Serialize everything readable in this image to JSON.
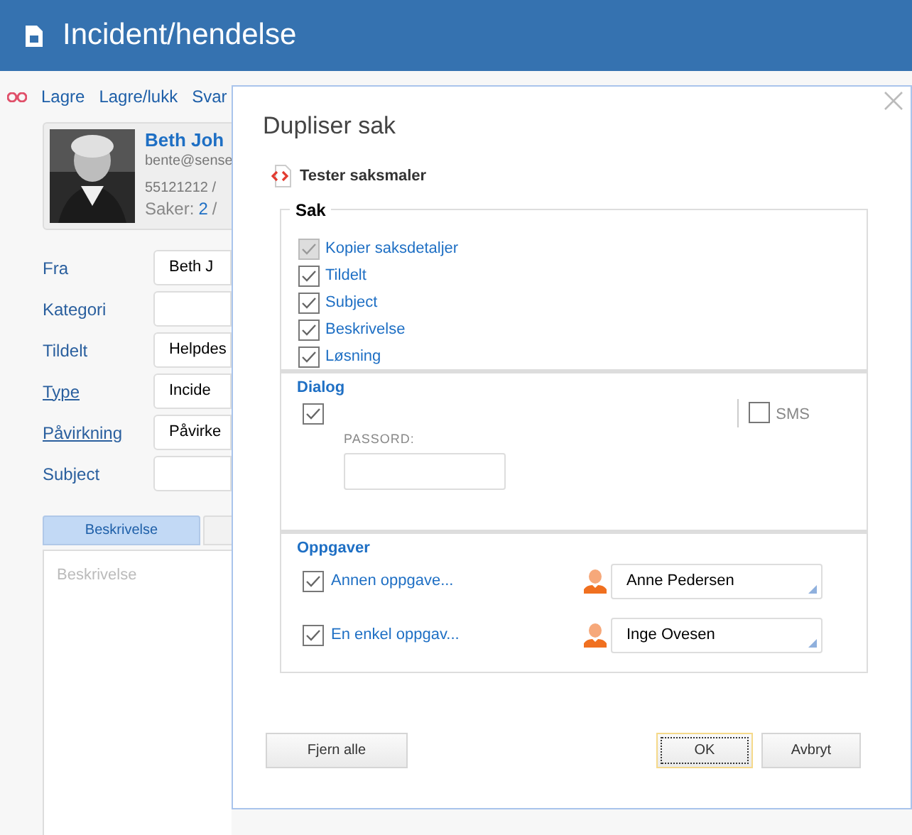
{
  "header": {
    "title": "Incident/hendelse"
  },
  "toolbar": [
    "Lagre",
    "Lagre/lukk",
    "Svar"
  ],
  "contact": {
    "name": "Beth Joh",
    "email": "bente@sense",
    "phone": "55121212 /",
    "cases_label": "Saker:",
    "cases_value": "2",
    "cases_sep": "/"
  },
  "form": [
    {
      "label": "Fra",
      "value": "Beth J",
      "link": false
    },
    {
      "label": "Kategori",
      "link": false
    },
    {
      "label": "Tildelt",
      "value": "Helpdes",
      "link": false
    },
    {
      "label": "Type",
      "value": "Incide",
      "link": true
    },
    {
      "label": "Påvirkning",
      "value": "Påvirke",
      "link": true
    },
    {
      "label": "Subject",
      "link": false
    }
  ],
  "tabs": [
    {
      "label": "Beskrivelse",
      "selected": true
    },
    {
      "selected": false
    }
  ],
  "description": {
    "placeholder": "Beskrivelse"
  },
  "dialog": {
    "title": "Dupliser sak",
    "template": "Tester saksmaler",
    "sak": {
      "legend": "Sak",
      "items": [
        {
          "label": "Kopier saksdetaljer",
          "checked": true,
          "disabled": true
        },
        {
          "label": "Tildelt",
          "checked": true,
          "disabled": false
        },
        {
          "label": "Subject",
          "checked": true,
          "disabled": false
        },
        {
          "label": "Beskrivelse",
          "checked": true,
          "disabled": false
        },
        {
          "label": "Løsning",
          "checked": true,
          "disabled": false
        }
      ]
    },
    "dialog_section": {
      "heading": "Dialog",
      "checked": true,
      "sms": {
        "label": "SMS",
        "checked": false
      },
      "password_label": "PASSORD:"
    },
    "tasks": {
      "heading": "Oppgaver",
      "items": [
        {
          "label": "Annen oppgave...",
          "checked": true,
          "assignee": "Anne Pedersen"
        },
        {
          "label": "En enkel oppgav...",
          "checked": true,
          "assignee": "Inge Ovesen"
        }
      ]
    },
    "buttons": {
      "remove_all": "Fjern alle",
      "ok": "OK",
      "cancel": "Avbryt"
    }
  }
}
